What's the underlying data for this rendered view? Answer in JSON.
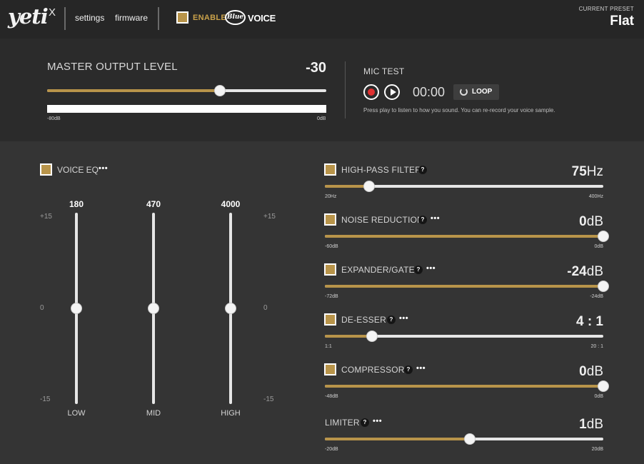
{
  "header": {
    "logo": "yeti",
    "logo_suffix": "X",
    "nav": [
      "settings",
      "firmware"
    ],
    "enable_label": "ENABLE",
    "brand_badge": "Blue",
    "brand_voice": "VOICE",
    "current_preset_caption": "CURRENT PRESET",
    "current_preset": "Flat"
  },
  "master": {
    "title": "MASTER OUTPUT LEVEL",
    "value": "-30",
    "slider_fraction": 0.62,
    "min_label": "-80dB",
    "max_label": "0dB"
  },
  "mic_test": {
    "title": "MIC TEST",
    "time": "00:00",
    "loop_label": "LOOP",
    "description": "Press play to listen to how you sound. You can re-record your voice sample."
  },
  "voice_eq": {
    "label": "VOICE EQ",
    "menu": "•••",
    "scale_top": "+15",
    "scale_mid": "0",
    "scale_bottom": "-15",
    "bands": [
      {
        "freq": "180",
        "name": "LOW",
        "gain_db": 0
      },
      {
        "freq": "470",
        "name": "MID",
        "gain_db": 0
      },
      {
        "freq": "4000",
        "name": "HIGH",
        "gain_db": 0
      }
    ]
  },
  "effects": {
    "help": "?",
    "menu": "•••",
    "items": [
      {
        "label": "HIGH-PASS FILTER",
        "value": "75",
        "unit": "Hz",
        "min": "20Hz",
        "max": "400Hz",
        "fraction": 0.16
      },
      {
        "label": "NOISE REDUCTION",
        "value": "0",
        "unit": "dB",
        "min": "-60dB",
        "max": "0dB",
        "fraction": 1.0
      },
      {
        "label": "EXPANDER/GATE",
        "value": "-24",
        "unit": "dB",
        "min": "-72dB",
        "max": "-24dB",
        "fraction": 1.0
      },
      {
        "label": "DE-ESSER",
        "value": "4 : 1",
        "unit": "",
        "min": "1:1",
        "max": "20 : 1",
        "fraction": 0.17
      },
      {
        "label": "COMPRESSOR",
        "value": "0",
        "unit": "dB",
        "min": "-48dB",
        "max": "0dB",
        "fraction": 1.0
      },
      {
        "label": "LIMITER",
        "value": "1",
        "unit": "dB",
        "min": "-20dB",
        "max": "20dB",
        "fraction": 0.52
      }
    ]
  },
  "colors": {
    "accent": "#b8944a",
    "header_bg": "#262626",
    "panel_bg": "#2b2b2b",
    "body_bg": "#343434",
    "record": "#e03131"
  }
}
